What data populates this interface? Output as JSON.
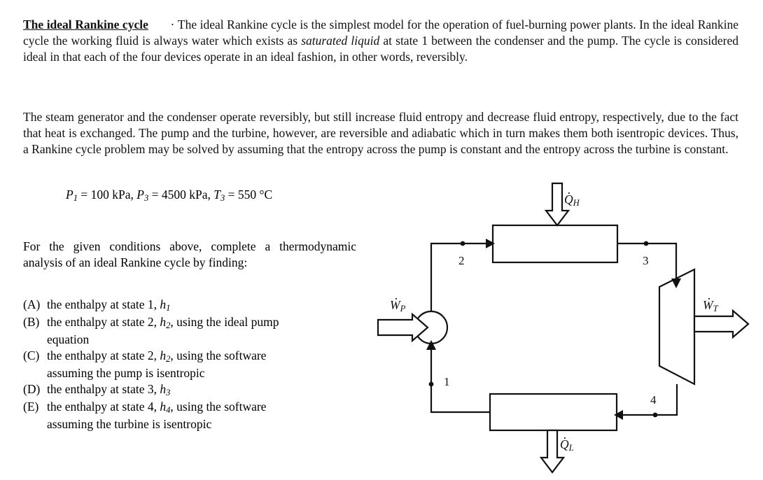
{
  "document": {
    "heading": "The ideal Rankine cycle",
    "paragraphs": {
      "intro_a": "The ideal Rankine cycle is the simplest model for the operation of fuel-burning power plants. In the ideal Rankine cycle the working fluid is always water which exists as ",
      "intro_italic": "saturated liquid",
      "intro_b": " at state 1 between the condenser and the pump. The cycle is considered ideal in that each of the four devices operate in an ideal fashion, in other words, reversibly.",
      "second": "The steam generator and the condenser operate reversibly, but still increase fluid entropy and decrease fluid entropy, respectively, due to the fact that heat is exchanged. The pump and the turbine, however, are reversible and adiabatic which in turn makes them both isentropic devices. Thus, a Rankine cycle problem may be solved by assuming that the entropy across the pump is constant and the entropy across the turbine is constant.",
      "task": "For the given conditions above, complete a thermodynamic analysis of an ideal Rankine cycle by finding:"
    },
    "conditions": {
      "p1_symbol": "P",
      "p1_sub": "1",
      "p1_value": "= 100 kPa,",
      "p3_symbol": "P",
      "p3_sub": "3",
      "p3_value": "= 4500 kPa,",
      "t3_symbol": "T",
      "t3_sub": "3",
      "t3_value": "= 550 °C",
      "full_text": "P1 = 100 kPa, P3 = 4500 kPa, T3 = 550 °C"
    },
    "answers": [
      {
        "marker": "(A)",
        "text_before": "the enthalpy at state 1, ",
        "var": "h",
        "var_sub": "1",
        "text_after": "",
        "continuation": ""
      },
      {
        "marker": "(B)",
        "text_before": "the enthalpy at state 2, ",
        "var": "h",
        "var_sub": "2",
        "text_after": ", using the ideal pump",
        "continuation": "equation"
      },
      {
        "marker": "(C)",
        "text_before": "the enthalpy at state 2, ",
        "var": "h",
        "var_sub": "2",
        "text_after": ", using the software",
        "continuation": "assuming the pump is isentropic"
      },
      {
        "marker": "(D)",
        "text_before": "the enthalpy at state 3, ",
        "var": "h",
        "var_sub": "3",
        "text_after": "",
        "continuation": ""
      },
      {
        "marker": "(E)",
        "text_before": "the enthalpy at state 4, ",
        "var": "h",
        "var_sub": "4",
        "text_after": ", using the software",
        "continuation": "assuming the turbine is isentropic"
      }
    ]
  },
  "diagram": {
    "type": "rankine-cycle-schematic",
    "stroke_color": "#111111",
    "fill_color": "#ffffff",
    "components": [
      {
        "name": "steam-generator",
        "shape": "rectangle"
      },
      {
        "name": "turbine",
        "shape": "trapezoid"
      },
      {
        "name": "condenser",
        "shape": "rectangle"
      },
      {
        "name": "pump",
        "shape": "circle"
      }
    ],
    "state_labels": [
      {
        "id": "1",
        "label": "1"
      },
      {
        "id": "2",
        "label": "2"
      },
      {
        "id": "3",
        "label": "3"
      },
      {
        "id": "4",
        "label": "4"
      }
    ],
    "energy_labels": {
      "qh_symbol": "Q",
      "qh_sub": "H",
      "ql_symbol": "Q",
      "ql_sub": "L",
      "wp_symbol": "W",
      "wp_sub": "P",
      "wt_symbol": "W",
      "wt_sub": "T"
    },
    "flow_arrows": [
      {
        "name": "heat-in-arrow",
        "label": "Q_H",
        "direction": "down",
        "style": "hollow-block"
      },
      {
        "name": "heat-out-arrow",
        "label": "Q_L",
        "direction": "down",
        "style": "hollow-block"
      },
      {
        "name": "pump-work-arrow",
        "label": "W_P",
        "direction": "right",
        "style": "hollow-block"
      },
      {
        "name": "turbine-work-arrow",
        "label": "W_T",
        "direction": "right",
        "style": "hollow-block"
      }
    ]
  }
}
